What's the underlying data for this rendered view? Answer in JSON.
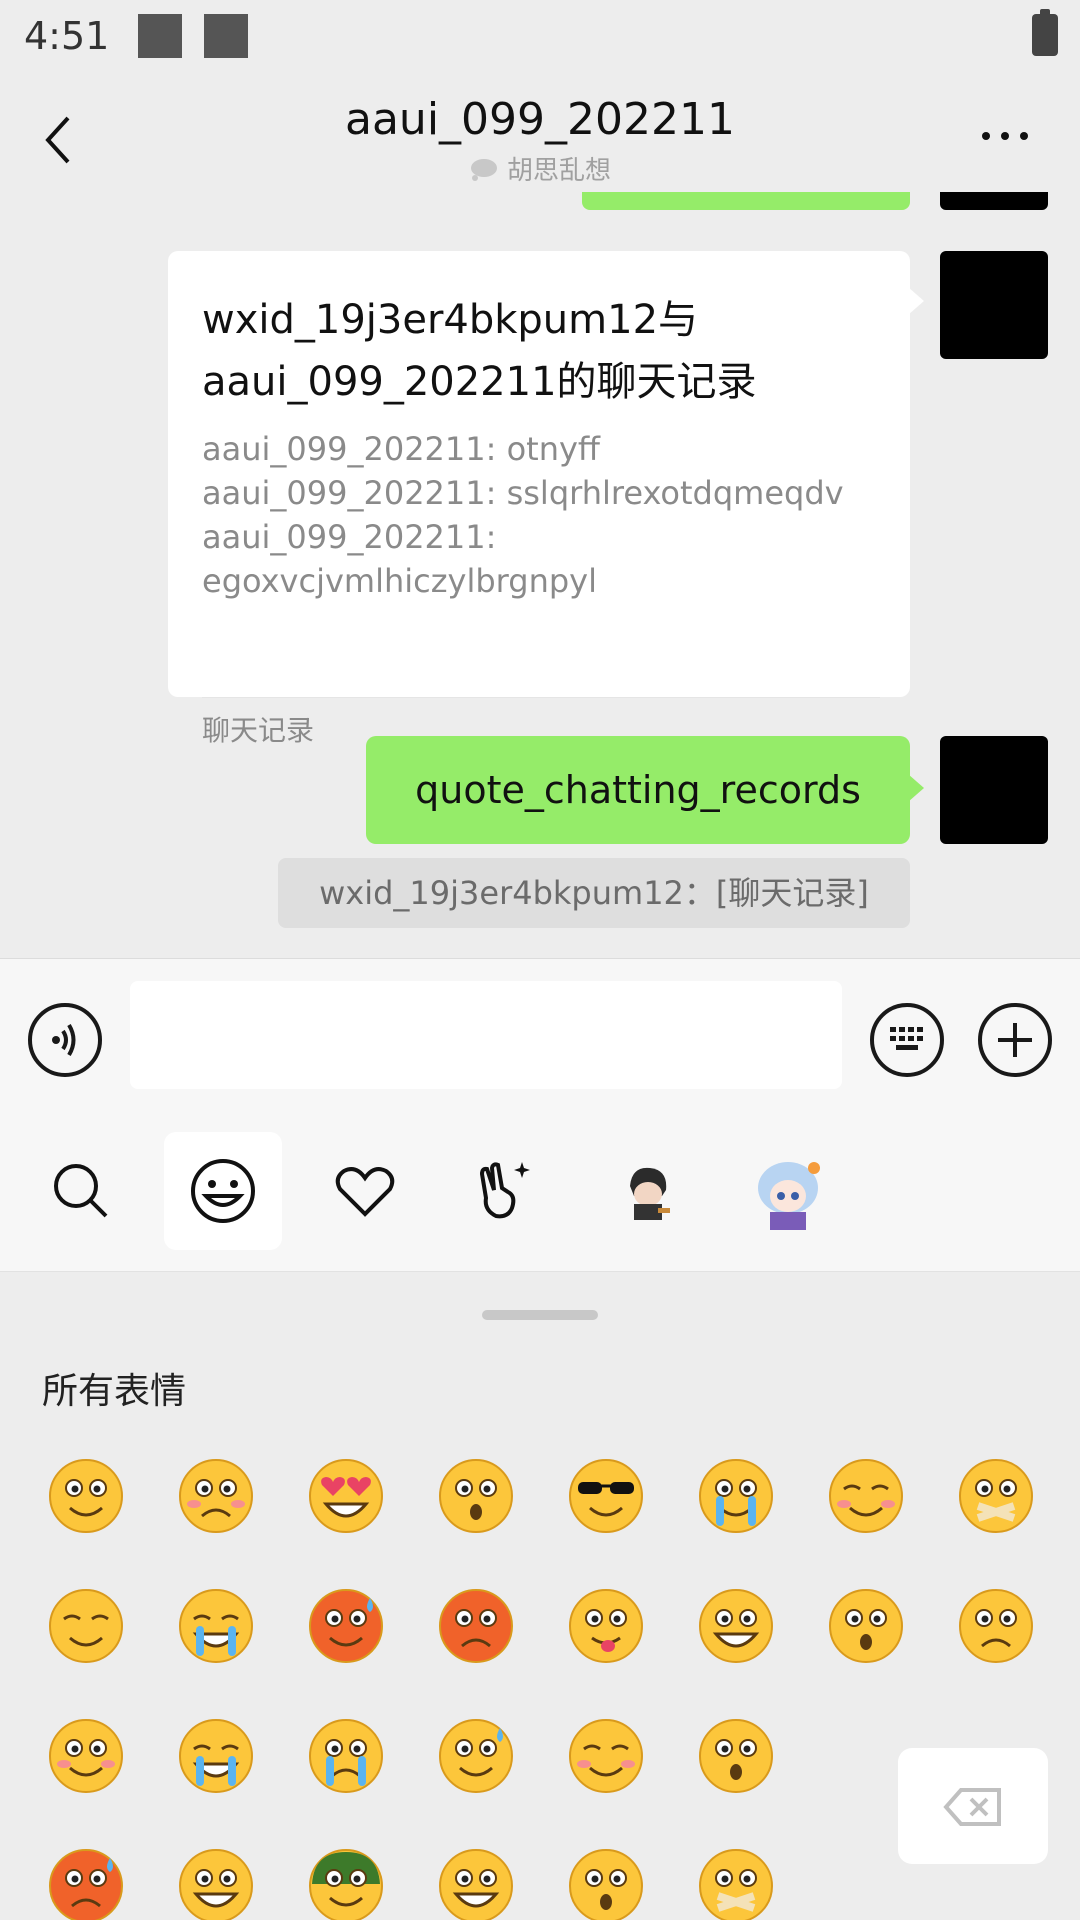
{
  "status_bar": {
    "time": "4:51"
  },
  "header": {
    "title": "aaui_099_202211",
    "subtitle": "胡思乱想",
    "icons": {
      "back": "chevron-left-icon",
      "more": "more-dots-icon",
      "subtitle": "chat-bubble-icon"
    }
  },
  "chat": {
    "record_card": {
      "title": "wxid_19j3er4bkpum12与aaui_099_202211的聊天记录",
      "lines": [
        "aaui_099_202211: otnyff",
        "aaui_099_202211: sslqrhlrexotdqmeqdv",
        "aaui_099_202211:",
        "egoxvcjvmlhiczylbrgnpyl"
      ],
      "footer": "聊天记录"
    },
    "message": "quote_chatting_records",
    "quote": "wxid_19j3er4bkpum12：[聊天记录]",
    "colors": {
      "bubble": "#95ec69",
      "background": "#ededed"
    }
  },
  "input_bar": {
    "value": "",
    "icons": {
      "voice": "voice-icon",
      "keyboard": "keyboard-icon",
      "plus": "plus-icon"
    }
  },
  "emoji_tabs": [
    "search-icon",
    "smiley-icon",
    "heart-icon",
    "gesture-icon",
    "sticker-character-1",
    "sticker-character-2"
  ],
  "emoji_panel": {
    "section_label": "所有表情",
    "emojis": [
      "smile",
      "worried",
      "heart-eyes",
      "stare",
      "cool-sunglasses",
      "crying",
      "shy",
      "mouth-taped",
      "sleepy",
      "tearful-grin",
      "sweat-red",
      "angry",
      "tongue-wink",
      "grin",
      "shocked",
      "frown",
      "blush",
      "laugh-cry",
      "sick",
      "facepalm",
      "smile-blush",
      "surprised",
      "furious",
      "big-grin",
      "army-helmet",
      "laughing",
      "question",
      "shush"
    ],
    "icons": {
      "delete": "backspace-icon"
    }
  }
}
